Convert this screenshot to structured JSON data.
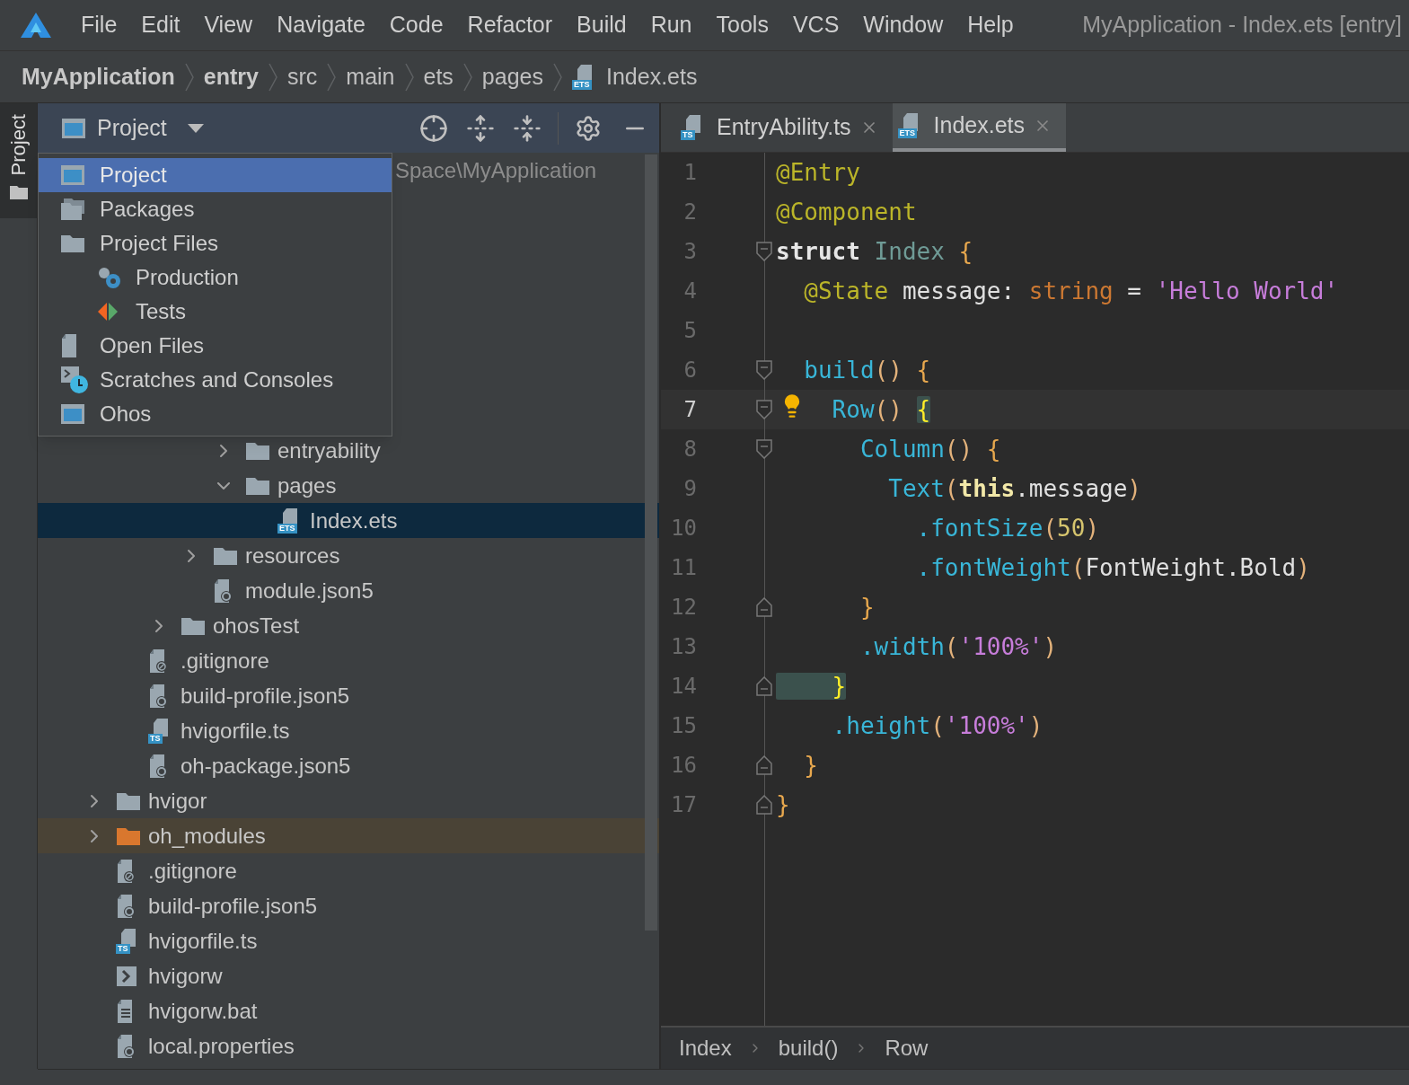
{
  "menu_bar": {
    "items": [
      "File",
      "Edit",
      "View",
      "Navigate",
      "Code",
      "Refactor",
      "Build",
      "Run",
      "Tools",
      "VCS",
      "Window",
      "Help"
    ],
    "title": "MyApplication - Index.ets [entry]"
  },
  "breadcrumb": [
    {
      "label": "MyApplication",
      "bold": true
    },
    {
      "label": "entry",
      "bold": true
    },
    {
      "label": "src",
      "bold": false
    },
    {
      "label": "main",
      "bold": false
    },
    {
      "label": "ets",
      "bold": false
    },
    {
      "label": "pages",
      "bold": false
    },
    {
      "label": "Index.ets",
      "bold": false,
      "badge": "ETS"
    }
  ],
  "side_strip": {
    "tabs": [
      {
        "label": "Project",
        "selected": true
      }
    ]
  },
  "project_panel": {
    "title": "Project",
    "view_menu": [
      {
        "label": "Project",
        "kind": "project",
        "selected": true
      },
      {
        "label": "Packages",
        "kind": "packages",
        "selected": false
      },
      {
        "label": "Project Files",
        "kind": "folder",
        "selected": false,
        "children": [
          {
            "label": "Production",
            "kind": "production",
            "selected": false
          },
          {
            "label": "Tests",
            "kind": "tests",
            "selected": false
          }
        ]
      },
      {
        "label": "Open Files",
        "kind": "open_files",
        "selected": false
      },
      {
        "label": "Scratches and Consoles",
        "kind": "scratches",
        "selected": false
      },
      {
        "label": "Ohos",
        "kind": "project",
        "selected": false
      }
    ],
    "tree": {
      "root_path": "Space\\MyApplication",
      "items": [
        {
          "kind": "covered"
        },
        {
          "kind": "covered"
        },
        {
          "kind": "covered"
        },
        {
          "kind": "covered",
          "children": [
            {
              "kind": "covered",
              "children": [
                {
                  "kind": "covered",
                  "children": [
                    {
                      "kind": "covered",
                      "children": [
                        {
                          "label": "entryability",
                          "kind": "folder",
                          "expanded": false,
                          "selected": false
                        },
                        {
                          "label": "pages",
                          "kind": "folder",
                          "expanded": true,
                          "selected": false,
                          "children": [
                            {
                              "label": "Index.ets",
                              "kind": "badge_file",
                              "badge": "ETS",
                              "selected": true
                            }
                          ]
                        }
                      ]
                    },
                    {
                      "label": "resources",
                      "kind": "folder",
                      "expanded": false,
                      "selected": false
                    },
                    {
                      "label": "module.json5",
                      "kind": "config",
                      "selected": false
                    }
                  ]
                },
                {
                  "label": "ohosTest",
                  "kind": "folder",
                  "expanded": false,
                  "selected": false
                }
              ]
            },
            {
              "label": ".gitignore",
              "kind": "ignore",
              "selected": false
            },
            {
              "label": "build-profile.json5",
              "kind": "config",
              "selected": false
            },
            {
              "label": "hvigorfile.ts",
              "kind": "badge_file",
              "badge": "TS",
              "selected": false
            },
            {
              "label": "oh-package.json5",
              "kind": "config",
              "selected": false
            }
          ]
        },
        {
          "label": "hvigor",
          "kind": "folder",
          "expanded": false,
          "selected": false
        },
        {
          "label": "oh_modules",
          "kind": "excluded_folder",
          "expanded": false,
          "selected": false
        },
        {
          "label": ".gitignore",
          "kind": "ignore",
          "selected": false
        },
        {
          "label": "build-profile.json5",
          "kind": "config",
          "selected": false
        },
        {
          "label": "hvigorfile.ts",
          "kind": "badge_file",
          "badge": "TS",
          "selected": false
        },
        {
          "label": "hvigorw",
          "kind": "script",
          "selected": false
        },
        {
          "label": "hvigorw.bat",
          "kind": "text",
          "selected": false
        },
        {
          "label": "local.properties",
          "kind": "config",
          "selected": false
        }
      ]
    }
  },
  "editor": {
    "tabs": [
      {
        "label": "EntryAbility.ts",
        "badge": "TS",
        "selected": false
      },
      {
        "label": "Index.ets",
        "badge": "ETS",
        "selected": true
      }
    ],
    "lines": [
      {
        "number": "1",
        "current": false,
        "bulb": false,
        "fold_open": false,
        "fold_close": false,
        "tokens": [
          {
            "text": "@Entry",
            "kind": "annotation"
          }
        ]
      },
      {
        "number": "2",
        "current": false,
        "bulb": false,
        "fold_open": false,
        "fold_close": false,
        "tokens": [
          {
            "text": "@Component",
            "kind": "annotation"
          }
        ]
      },
      {
        "number": "3",
        "current": false,
        "bulb": false,
        "fold_open": true,
        "fold_close": false,
        "tokens": [
          {
            "text": "struct ",
            "kind": "keyword"
          },
          {
            "text": "Index ",
            "kind": "type"
          },
          {
            "text": "{",
            "kind": "brace"
          }
        ]
      },
      {
        "number": "4",
        "current": false,
        "bulb": false,
        "fold_open": false,
        "fold_close": false,
        "tokens": [
          {
            "text": "  @State",
            "kind": "annotation"
          },
          {
            "text": " message: ",
            "kind": "plain"
          },
          {
            "text": "string",
            "kind": "type_keyword"
          },
          {
            "text": " = ",
            "kind": "plain"
          },
          {
            "text": "'Hello World'",
            "kind": "string"
          }
        ]
      },
      {
        "number": "5",
        "current": false,
        "bulb": false,
        "fold_open": false,
        "fold_close": false
      },
      {
        "number": "6",
        "current": false,
        "bulb": false,
        "fold_open": true,
        "fold_close": false,
        "tokens": [
          {
            "text": "  build",
            "kind": "function"
          },
          {
            "text": "() ",
            "kind": "paren"
          },
          {
            "text": "{",
            "kind": "brace"
          }
        ]
      },
      {
        "number": "7",
        "current": true,
        "bulb": true,
        "fold_open": true,
        "fold_close": false,
        "tokens": [
          {
            "text": "    Row",
            "kind": "function"
          },
          {
            "text": "() ",
            "kind": "paren"
          },
          {
            "text": "{",
            "kind": "brace_match"
          }
        ]
      },
      {
        "number": "8",
        "current": false,
        "bulb": false,
        "fold_open": true,
        "fold_close": false,
        "tokens": [
          {
            "text": "      Column",
            "kind": "function"
          },
          {
            "text": "() ",
            "kind": "paren"
          },
          {
            "text": "{",
            "kind": "brace"
          }
        ]
      },
      {
        "number": "9",
        "current": false,
        "bulb": false,
        "fold_open": false,
        "fold_close": false,
        "tokens": [
          {
            "text": "        Text",
            "kind": "function"
          },
          {
            "text": "(",
            "kind": "paren"
          },
          {
            "text": "this",
            "kind": "this"
          },
          {
            "text": ".message",
            "kind": "plain"
          },
          {
            "text": ")",
            "kind": "paren"
          }
        ]
      },
      {
        "number": "10",
        "current": false,
        "bulb": false,
        "fold_open": false,
        "fold_close": false,
        "tokens": [
          {
            "text": "          .fontSize",
            "kind": "function"
          },
          {
            "text": "(",
            "kind": "paren"
          },
          {
            "text": "50",
            "kind": "number"
          },
          {
            "text": ")",
            "kind": "paren"
          }
        ]
      },
      {
        "number": "11",
        "current": false,
        "bulb": false,
        "fold_open": false,
        "fold_close": false,
        "tokens": [
          {
            "text": "          .fontWeight",
            "kind": "function"
          },
          {
            "text": "(",
            "kind": "paren"
          },
          {
            "text": "FontWeight.Bold",
            "kind": "plain"
          },
          {
            "text": ")",
            "kind": "paren"
          }
        ]
      },
      {
        "number": "12",
        "current": false,
        "bulb": false,
        "fold_open": false,
        "fold_close": true,
        "tokens": [
          {
            "text": "      }",
            "kind": "brace"
          }
        ]
      },
      {
        "number": "13",
        "current": false,
        "bulb": false,
        "fold_open": false,
        "fold_close": false,
        "tokens": [
          {
            "text": "      .width",
            "kind": "function"
          },
          {
            "text": "(",
            "kind": "paren"
          },
          {
            "text": "'100%'",
            "kind": "string"
          },
          {
            "text": ")",
            "kind": "paren"
          }
        ]
      },
      {
        "number": "14",
        "current": false,
        "bulb": false,
        "fold_open": false,
        "fold_close": true,
        "tokens": [
          {
            "text": "    }",
            "kind": "brace_match"
          }
        ]
      },
      {
        "number": "15",
        "current": false,
        "bulb": false,
        "fold_open": false,
        "fold_close": false,
        "tokens": [
          {
            "text": "    .height",
            "kind": "function"
          },
          {
            "text": "(",
            "kind": "paren"
          },
          {
            "text": "'100%'",
            "kind": "string"
          },
          {
            "text": ")",
            "kind": "paren"
          }
        ]
      },
      {
        "number": "16",
        "current": false,
        "bulb": false,
        "fold_open": false,
        "fold_close": true,
        "tokens": [
          {
            "text": "  }",
            "kind": "brace"
          }
        ]
      },
      {
        "number": "17",
        "current": false,
        "bulb": false,
        "fold_open": false,
        "fold_close": true,
        "tokens": [
          {
            "text": "}",
            "kind": "brace"
          }
        ]
      }
    ],
    "breadcrumb": [
      "Index",
      "build()",
      "Row"
    ]
  }
}
